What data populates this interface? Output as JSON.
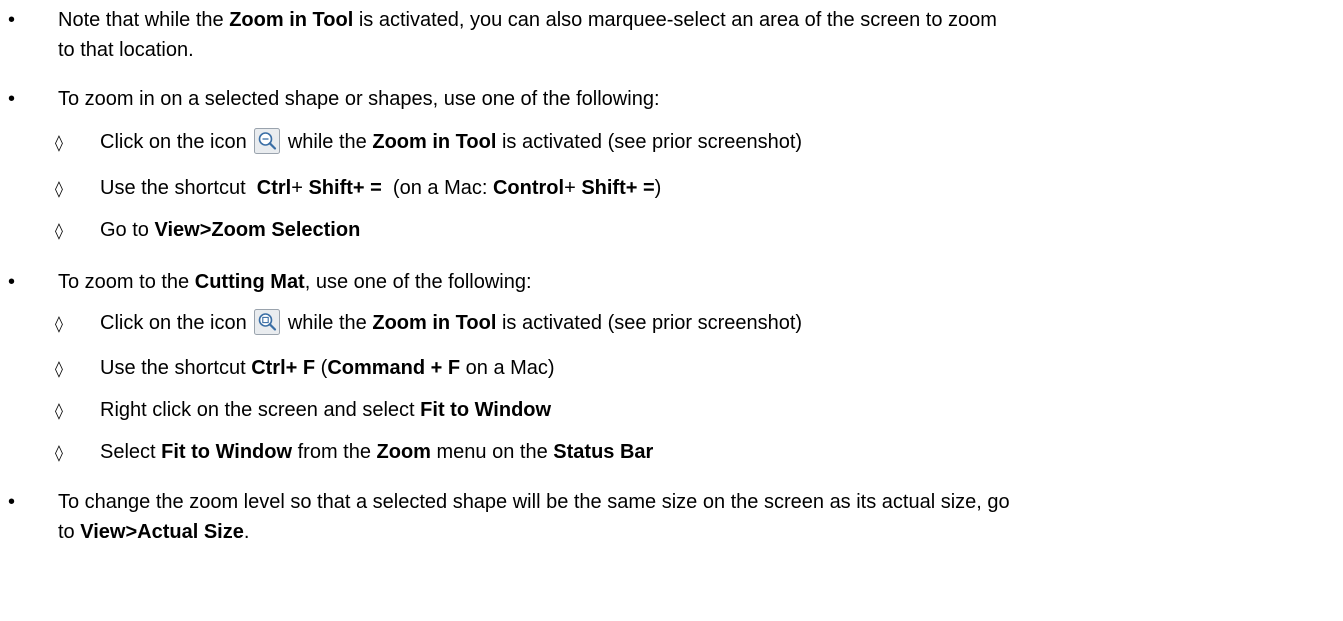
{
  "items": [
    {
      "line1": {
        "a": "Note that while the ",
        "b": "Zoom in Tool",
        "c": " is activated, you can also marquee-select an area of the screen to zoom"
      },
      "line2": "to that location."
    },
    {
      "text": "To zoom in on a selected shape or shapes, use one of the following:",
      "subs": [
        {
          "a": "Click on the icon ",
          "icon": "zoom-to-selection-icon",
          "b": " while the ",
          "c": "Zoom in Tool",
          "d": " is activated (see prior screenshot)"
        },
        {
          "a": "Use the shortcut  ",
          "b": "Ctrl",
          "c": "+ ",
          "d": "Shift",
          "e": "+ =",
          "f": "  (on a Mac: ",
          "g": "Control",
          "h": "+ ",
          "i": "Shift",
          "j": "+ =",
          "k": ")"
        },
        {
          "a": "Go to ",
          "b": "View>Zoom Selection"
        }
      ]
    },
    {
      "a": "To zoom to the ",
      "b": "Cutting Mat",
      "c": ", use one of the following:",
      "subs": [
        {
          "a": "Click on the icon ",
          "icon": "zoom-to-mat-icon",
          "b": " while the ",
          "c": "Zoom in Tool",
          "d": " is activated (see prior screenshot)"
        },
        {
          "a": "Use the shortcut ",
          "b": "Ctrl+ F",
          "c": " (",
          "d": "Command + F",
          "e": " on a Mac)"
        },
        {
          "a": "Right click on the screen and select ",
          "b": "Fit to Window"
        },
        {
          "a": "Select ",
          "b": "Fit to Window",
          "c": " from the ",
          "d": "Zoom",
          "e": " menu on the ",
          "f": "Status Bar"
        }
      ]
    },
    {
      "line1": "To change the zoom level so that a selected shape will be the same size on the screen as its actual size, go",
      "line2": {
        "a": "to ",
        "b": "View>Actual Size",
        "c": "."
      }
    }
  ],
  "symbols": {
    "bullet": "•",
    "sub_bullet": "◊"
  },
  "colors": {
    "icon_border": "#9aa3ad",
    "icon_bg": "#e9ecef",
    "icon_lens": "#3a6ea5"
  }
}
